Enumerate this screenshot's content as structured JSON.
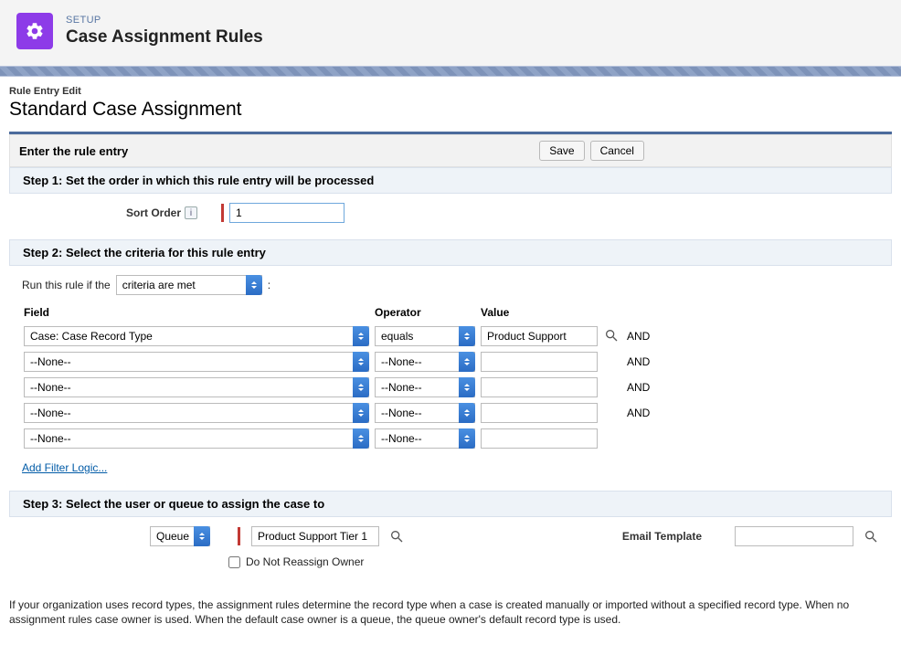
{
  "header": {
    "setup_label": "SETUP",
    "page_title": "Case Assignment Rules"
  },
  "breadcrumb": "Rule Entry Edit",
  "rule_name": "Standard Case Assignment",
  "enter_section": {
    "title": "Enter the rule entry",
    "save_label": "Save",
    "cancel_label": "Cancel"
  },
  "step1": {
    "title": "Step 1: Set the order in which this rule entry will be processed",
    "sort_order_label": "Sort Order",
    "sort_order_value": "1"
  },
  "step2": {
    "title": "Step 2: Select the criteria for this rule entry",
    "run_prefix": "Run this rule if the",
    "run_option": "criteria are met",
    "colon": ":",
    "columns": {
      "field": "Field",
      "operator": "Operator",
      "value": "Value"
    },
    "and_label": "AND",
    "rows": [
      {
        "field": "Case: Case Record Type",
        "operator": "equals",
        "value": "Product Support",
        "show_and": true,
        "show_lookup": true
      },
      {
        "field": "--None--",
        "operator": "--None--",
        "value": "",
        "show_and": true,
        "show_lookup": false
      },
      {
        "field": "--None--",
        "operator": "--None--",
        "value": "",
        "show_and": true,
        "show_lookup": false
      },
      {
        "field": "--None--",
        "operator": "--None--",
        "value": "",
        "show_and": true,
        "show_lookup": false
      },
      {
        "field": "--None--",
        "operator": "--None--",
        "value": "",
        "show_and": false,
        "show_lookup": false
      }
    ],
    "add_filter_logic": "Add Filter Logic..."
  },
  "step3": {
    "title": "Step 3: Select the user or queue to assign the case to",
    "assignee_type": "Queue",
    "assignee_value": "Product Support Tier 1",
    "email_template_label": "Email Template",
    "email_template_value": "",
    "do_not_reassign_label": "Do Not Reassign Owner",
    "do_not_reassign_checked": false
  },
  "note": "If your organization uses record types, the assignment rules determine the record type when a case is created manually or imported without a specified record type. When no assignment rules case owner is used. When the default case owner is a queue, the queue owner's default record type is used."
}
